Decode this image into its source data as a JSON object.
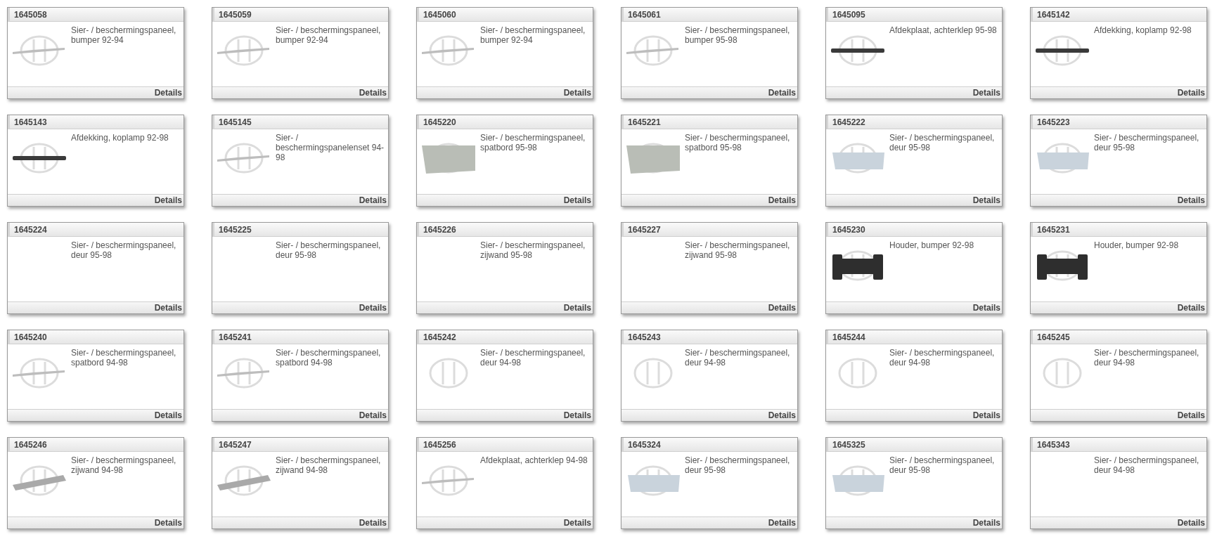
{
  "cards": [
    {
      "number": "1645058",
      "description": "Sier- / beschermingspaneel, bumper 92-94",
      "kind": "trim",
      "link": "Details"
    },
    {
      "number": "1645059",
      "description": "Sier- / beschermingspaneel, bumper 92-94",
      "kind": "trim",
      "link": "Details"
    },
    {
      "number": "1645060",
      "description": "Sier- / beschermingspaneel, bumper 92-94",
      "kind": "trim",
      "link": "Details"
    },
    {
      "number": "1645061",
      "description": "Sier- / beschermingspaneel, bumper 95-98",
      "kind": "trim",
      "link": "Details"
    },
    {
      "number": "1645095",
      "description": "Afdekplaat, achterklep 95-98",
      "kind": "bar",
      "link": "Details"
    },
    {
      "number": "1645142",
      "description": "Afdekking, koplamp 92-98",
      "kind": "bar",
      "link": "Details"
    },
    {
      "number": "1645143",
      "description": "Afdekking, koplamp 92-98",
      "kind": "bar",
      "link": "Details"
    },
    {
      "number": "1645145",
      "description": "Sier- / beschermingspanelenset 94-98",
      "kind": "trim",
      "link": "Details"
    },
    {
      "number": "1645220",
      "description": "Sier- / beschermingspaneel, spatbord 95-98",
      "kind": "panel",
      "link": "Details"
    },
    {
      "number": "1645221",
      "description": "Sier- / beschermingspaneel, spatbord 95-98",
      "kind": "panel",
      "link": "Details"
    },
    {
      "number": "1645222",
      "description": "Sier- / beschermingspaneel, deur 95-98",
      "kind": "door",
      "link": "Details"
    },
    {
      "number": "1645223",
      "description": "Sier- / beschermingspaneel, deur 95-98",
      "kind": "door",
      "link": "Details"
    },
    {
      "number": "1645224",
      "description": "Sier- / beschermingspaneel, deur 95-98",
      "kind": "none",
      "link": "Details"
    },
    {
      "number": "1645225",
      "description": "Sier- / beschermingspaneel, deur 95-98",
      "kind": "none",
      "link": "Details"
    },
    {
      "number": "1645226",
      "description": "Sier- / beschermingspaneel, zijwand 95-98",
      "kind": "none",
      "link": "Details"
    },
    {
      "number": "1645227",
      "description": "Sier- / beschermingspaneel, zijwand 95-98",
      "kind": "none",
      "link": "Details"
    },
    {
      "number": "1645230",
      "description": "Houder, bumper 92-98",
      "kind": "holder",
      "link": "Details"
    },
    {
      "number": "1645231",
      "description": "Houder, bumper 92-98",
      "kind": "holder",
      "link": "Details"
    },
    {
      "number": "1645240",
      "description": "Sier- / beschermingspaneel, spatbord 94-98",
      "kind": "trim",
      "link": "Details"
    },
    {
      "number": "1645241",
      "description": "Sier- / beschermingspaneel, spatbord 94-98",
      "kind": "trim",
      "link": "Details"
    },
    {
      "number": "1645242",
      "description": "Sier- / beschermingspaneel, deur 94-98",
      "kind": "logo",
      "link": "Details"
    },
    {
      "number": "1645243",
      "description": "Sier- / beschermingspaneel, deur 94-98",
      "kind": "logo",
      "link": "Details"
    },
    {
      "number": "1645244",
      "description": "Sier- / beschermingspaneel, deur 94-98",
      "kind": "logo",
      "link": "Details"
    },
    {
      "number": "1645245",
      "description": "Sier- / beschermingspaneel, deur 94-98",
      "kind": "logo",
      "link": "Details"
    },
    {
      "number": "1645246",
      "description": "Sier- / beschermingspaneel, zijwand 94-98",
      "kind": "plank",
      "link": "Details"
    },
    {
      "number": "1645247",
      "description": "Sier- / beschermingspaneel, zijwand 94-98",
      "kind": "plank",
      "link": "Details"
    },
    {
      "number": "1645256",
      "description": "Afdekplaat, achterklep 94-98",
      "kind": "trim",
      "link": "Details"
    },
    {
      "number": "1645324",
      "description": "Sier- / beschermingspaneel, deur 95-98",
      "kind": "door",
      "link": "Details"
    },
    {
      "number": "1645325",
      "description": "Sier- / beschermingspaneel, deur 95-98",
      "kind": "door",
      "link": "Details"
    },
    {
      "number": "1645343",
      "description": "Sier- / beschermingspaneel, deur 94-98",
      "kind": "none",
      "link": "Details"
    }
  ]
}
